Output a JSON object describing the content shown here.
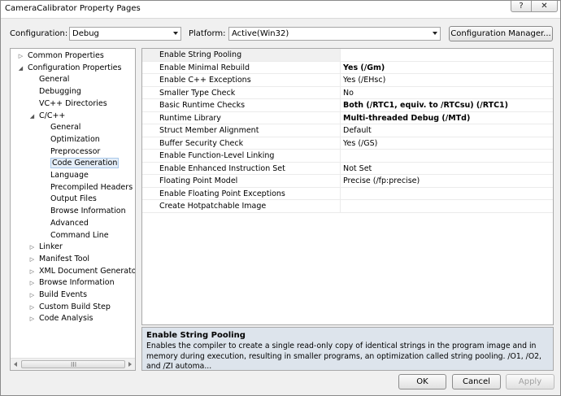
{
  "window": {
    "title": "CameraCalibrator Property Pages",
    "help_glyph": "?",
    "close_glyph": "✕"
  },
  "toolbar": {
    "configuration_label": "Configuration:",
    "configuration_value": "Debug",
    "platform_label": "Platform:",
    "platform_value": "Active(Win32)",
    "config_manager_button": "Configuration Manager..."
  },
  "tree": {
    "items": [
      {
        "label": "Common Properties",
        "toggle": "▷"
      },
      {
        "label": "Configuration Properties",
        "toggle": "◢"
      },
      {
        "label": "General",
        "toggle": ""
      },
      {
        "label": "Debugging",
        "toggle": ""
      },
      {
        "label": "VC++ Directories",
        "toggle": ""
      },
      {
        "label": "C/C++",
        "toggle": "◢"
      },
      {
        "label": "General",
        "toggle": ""
      },
      {
        "label": "Optimization",
        "toggle": ""
      },
      {
        "label": "Preprocessor",
        "toggle": ""
      },
      {
        "label": "Code Generation",
        "toggle": ""
      },
      {
        "label": "Language",
        "toggle": ""
      },
      {
        "label": "Precompiled Headers",
        "toggle": ""
      },
      {
        "label": "Output Files",
        "toggle": ""
      },
      {
        "label": "Browse Information",
        "toggle": ""
      },
      {
        "label": "Advanced",
        "toggle": ""
      },
      {
        "label": "Command Line",
        "toggle": ""
      },
      {
        "label": "Linker",
        "toggle": "▷"
      },
      {
        "label": "Manifest Tool",
        "toggle": "▷"
      },
      {
        "label": "XML Document Generator",
        "toggle": "▷"
      },
      {
        "label": "Browse Information",
        "toggle": "▷"
      },
      {
        "label": "Build Events",
        "toggle": "▷"
      },
      {
        "label": "Custom Build Step",
        "toggle": "▷"
      },
      {
        "label": "Code Analysis",
        "toggle": "▷"
      }
    ],
    "scroll_grip": "III"
  },
  "grid": {
    "rows": [
      {
        "name": "Enable String Pooling",
        "value": "",
        "bold": false
      },
      {
        "name": "Enable Minimal Rebuild",
        "value": "Yes (/Gm)",
        "bold": true
      },
      {
        "name": "Enable C++ Exceptions",
        "value": "Yes (/EHsc)",
        "bold": false
      },
      {
        "name": "Smaller Type Check",
        "value": "No",
        "bold": false
      },
      {
        "name": "Basic Runtime Checks",
        "value": "Both (/RTC1, equiv. to /RTCsu) (/RTC1)",
        "bold": true
      },
      {
        "name": "Runtime Library",
        "value": "Multi-threaded Debug (/MTd)",
        "bold": true
      },
      {
        "name": "Struct Member Alignment",
        "value": "Default",
        "bold": false
      },
      {
        "name": "Buffer Security Check",
        "value": "Yes (/GS)",
        "bold": false
      },
      {
        "name": "Enable Function-Level Linking",
        "value": "",
        "bold": false
      },
      {
        "name": "Enable Enhanced Instruction Set",
        "value": "Not Set",
        "bold": false
      },
      {
        "name": "Floating Point Model",
        "value": "Precise (/fp:precise)",
        "bold": false
      },
      {
        "name": "Enable Floating Point Exceptions",
        "value": "",
        "bold": false
      },
      {
        "name": "Create Hotpatchable Image",
        "value": "",
        "bold": false
      }
    ]
  },
  "description": {
    "title": "Enable String Pooling",
    "text": "Enables the compiler to create a single read-only copy of identical strings in the program image and in memory during execution, resulting in smaller programs, an optimization called string pooling. /O1, /O2, and /ZI automa..."
  },
  "buttons": {
    "ok": "OK",
    "cancel": "Cancel",
    "apply": "Apply"
  }
}
